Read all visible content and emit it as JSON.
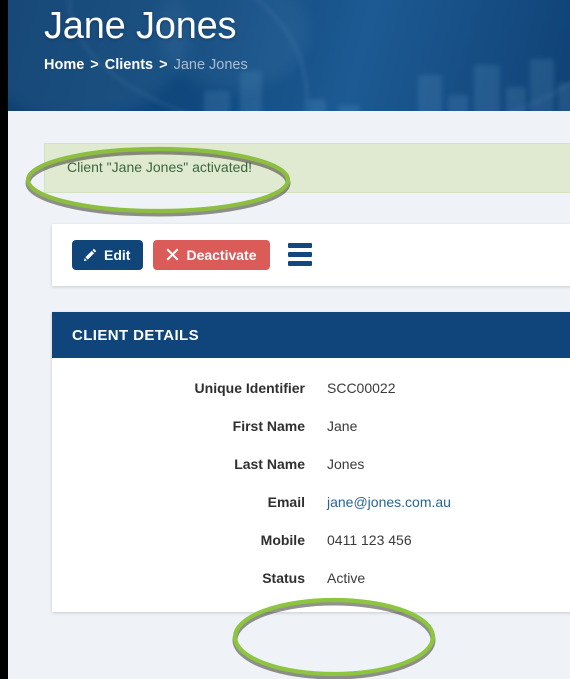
{
  "header": {
    "title": "Jane Jones",
    "breadcrumb": {
      "home": "Home",
      "separator1": ">",
      "clients": "Clients",
      "separator2": ">",
      "current": "Jane Jones"
    },
    "background_color": "#10487d"
  },
  "alert": {
    "message": "Client \"Jane Jones\" activated!",
    "background_color": "#dfead0",
    "text_color": "#3c663c"
  },
  "toolbar": {
    "edit_label": "Edit",
    "edit_icon": "pencil-icon",
    "edit_color": "#0f4579",
    "deactivate_label": "Deactivate",
    "deactivate_icon": "x-icon",
    "deactivate_color": "#da5b57",
    "menu_icon": "hamburger-menu-icon"
  },
  "panel": {
    "heading": "CLIENT DETAILS",
    "heading_background": "#10457b",
    "rows": [
      {
        "label": "Unique Identifier",
        "value": "SCC00022",
        "is_link": false
      },
      {
        "label": "First Name",
        "value": "Jane",
        "is_link": false
      },
      {
        "label": "Last Name",
        "value": "Jones",
        "is_link": false
      },
      {
        "label": "Email",
        "value": "jane@jones.com.au",
        "is_link": true
      },
      {
        "label": "Mobile",
        "value": "0411 123 456",
        "is_link": false
      },
      {
        "label": "Status",
        "value": "Active",
        "is_link": false
      }
    ]
  },
  "annotations": {
    "color": "#8cc63e",
    "items": [
      {
        "name": "alert-highlight-ellipse",
        "target": "alert-message"
      },
      {
        "name": "status-highlight-ellipse",
        "target": "status-row"
      }
    ]
  }
}
